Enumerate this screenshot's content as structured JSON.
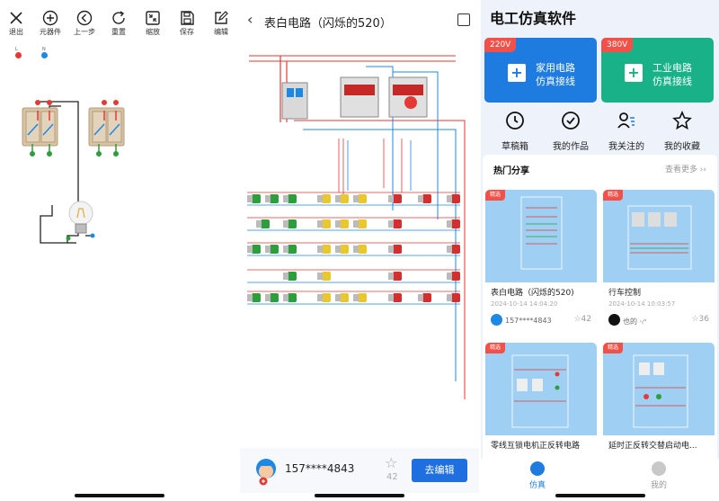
{
  "editor": {
    "toolbar": [
      {
        "icon": "close-icon",
        "label": "退出"
      },
      {
        "icon": "add-circle-icon",
        "label": "元器件"
      },
      {
        "icon": "back-circle-icon",
        "label": "上一步"
      },
      {
        "icon": "refresh-icon",
        "label": "重置"
      },
      {
        "icon": "shrink-icon",
        "label": "缩放"
      },
      {
        "icon": "save-icon",
        "label": "保存"
      },
      {
        "icon": "edit-icon",
        "label": "编辑"
      }
    ],
    "terminal_l": "L",
    "terminal_n": "N",
    "colors": {
      "live": "#e53935",
      "neutral": "#1e88e5",
      "wire": "#222222",
      "green": "#2e9d3c",
      "switch": "#d7c3a5"
    }
  },
  "preview": {
    "title": "表白电路（闪烁的520）",
    "username": "157****4843",
    "likes": "42",
    "edit_label": "去编辑"
  },
  "home": {
    "app_title": "电工仿真软件",
    "cards": [
      {
        "tag": "220V",
        "line1": "家用电路",
        "line2": "仿真接线",
        "color": "#1e7be0"
      },
      {
        "tag": "380V",
        "line1": "工业电路",
        "line2": "仿真接线",
        "color": "#19b187"
      }
    ],
    "quick_actions": [
      {
        "icon": "clock-icon",
        "label": "草稿箱"
      },
      {
        "icon": "check-circle-icon",
        "label": "我的作品"
      },
      {
        "icon": "user-list-icon",
        "label": "我关注的"
      },
      {
        "icon": "star-icon",
        "label": "我的收藏"
      }
    ],
    "share_title": "热门分享",
    "share_more": "查看更多 ››",
    "posts": [
      {
        "badge": "精选",
        "title": "表白电路（闪烁的520)",
        "date": "2024-10-14 14:04:20",
        "user": "157****4843",
        "likes": "42"
      },
      {
        "badge": "精选",
        "title": "行车控制",
        "date": "2024-10-14 10:03:57",
        "user": "也的 ·₍ᐢ",
        "likes": "36"
      },
      {
        "badge": "精选",
        "title": "零线互锁电机正反转电路",
        "date": "",
        "user": "",
        "likes": ""
      },
      {
        "badge": "精选",
        "title": "延时正反转交替启动电...",
        "date": "",
        "user": "",
        "likes": ""
      }
    ],
    "tabs": [
      {
        "icon": "bulb-icon",
        "label": "仿真",
        "active": true
      },
      {
        "icon": "person-icon",
        "label": "我的",
        "active": false
      }
    ]
  }
}
